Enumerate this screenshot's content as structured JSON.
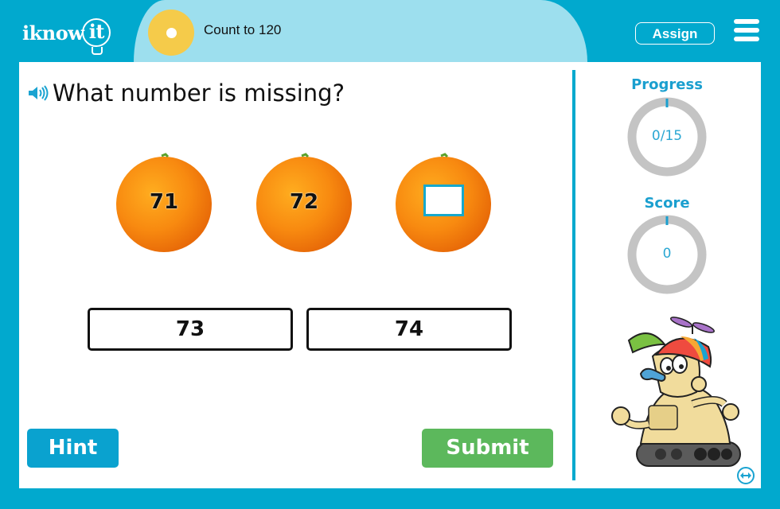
{
  "header": {
    "logo_text": "iknow",
    "logo_bulb_text": "it",
    "lesson_title": "Count to 120",
    "assign_label": "Assign",
    "menu_icon": "hamburger-menu-icon"
  },
  "question": {
    "speaker_icon": "speaker-icon",
    "prompt": "What number is missing?",
    "sequence": [
      {
        "value": "71",
        "missing": false
      },
      {
        "value": "72",
        "missing": false
      },
      {
        "value": "",
        "missing": true
      }
    ],
    "choices": [
      "73",
      "74"
    ]
  },
  "actions": {
    "hint_label": "Hint",
    "submit_label": "Submit"
  },
  "sidebar": {
    "progress": {
      "label": "Progress",
      "value_text": "0/15",
      "current": 0,
      "total": 15
    },
    "score": {
      "label": "Score",
      "value_text": "0",
      "value": 0
    },
    "swap_icon": "swap-horizontal-icon"
  },
  "colors": {
    "brand": "#01a9ce",
    "lesson_bar": "#9ddfee",
    "lesson_dot": "#f5cb4a",
    "hint": "#0aa2cf",
    "submit": "#5cb85c",
    "ring_track": "#c4c4c4",
    "stat_text": "#1a9fcf"
  }
}
